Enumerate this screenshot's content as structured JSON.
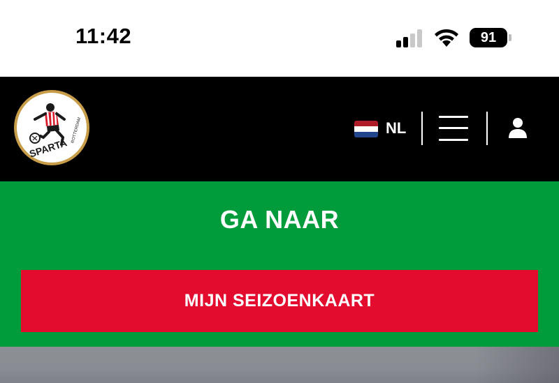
{
  "status_bar": {
    "time": "11:42",
    "battery": "91",
    "signal_icon": "cellular-signal-icon",
    "wifi_icon": "wifi-icon"
  },
  "header": {
    "logo_name": "sparta-rotterdam-logo",
    "logo_text_main": "SPARTA",
    "logo_text_sub": "ROTTERDAM",
    "language": "NL",
    "flag_colors": [
      "#AE1C28",
      "#FFFFFF",
      "#21468B"
    ],
    "menu_icon": "hamburger-menu-icon",
    "user_icon": "user-icon"
  },
  "goto": {
    "title": "GA NAAR",
    "button_label": "MIJN SEIZOENKAART"
  },
  "colors": {
    "header_bg": "#000000",
    "green": "#009c3b",
    "red": "#e30b2e"
  }
}
